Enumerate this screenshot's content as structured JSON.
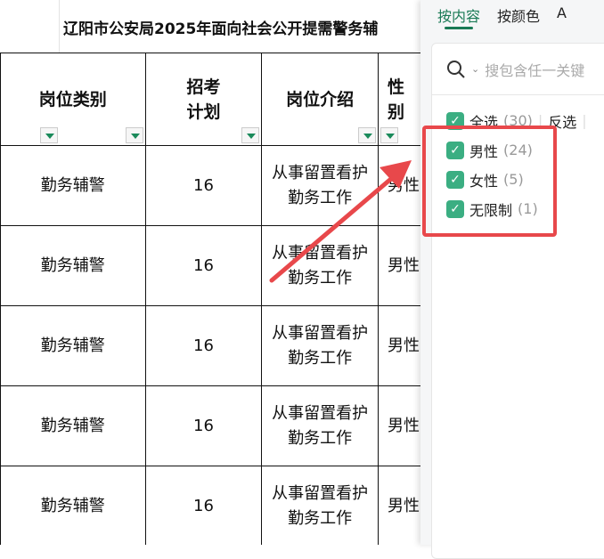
{
  "sheet": {
    "title": "辽阳市公安局2025年面向社会公开提需警务辅",
    "headers": [
      "岗位类别",
      "招考\n计划",
      "岗位介绍",
      "性\n别"
    ],
    "rows": [
      {
        "type": "勤务辅警",
        "plan": "16",
        "intro": "从事留置看护勤务工作",
        "gender": "男性"
      },
      {
        "type": "勤务辅警",
        "plan": "16",
        "intro": "从事留置看护勤务工作",
        "gender": "男性"
      },
      {
        "type": "勤务辅警",
        "plan": "16",
        "intro": "从事留置看护勤务工作",
        "gender": "男性"
      },
      {
        "type": "勤务辅警",
        "plan": "16",
        "intro": "从事留置看护勤务工作",
        "gender": "男性"
      },
      {
        "type": "勤务辅警",
        "plan": "16",
        "intro": "从事留置看护勤务工作",
        "gender": "男性"
      }
    ]
  },
  "filter": {
    "tabs": [
      "按内容",
      "按颜色",
      "A"
    ],
    "search_placeholder": "搜包含任一关键",
    "select_all": "全选",
    "select_all_count": "(30)",
    "invert": "反选",
    "items": [
      {
        "label": "男性",
        "count": "(24)",
        "checked": true
      },
      {
        "label": "女性",
        "count": "(5)",
        "checked": true
      },
      {
        "label": "无限制",
        "count": "(1)",
        "checked": true
      }
    ]
  },
  "colors": {
    "accent": "#1a7a55",
    "checkbox": "#3bae82",
    "highlight": "#e8484b"
  }
}
